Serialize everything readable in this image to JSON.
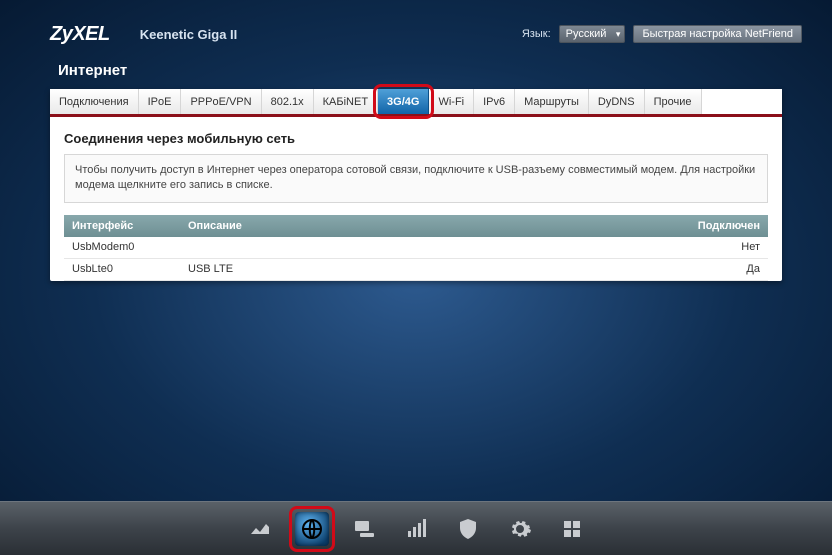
{
  "header": {
    "brand": "ZyXEL",
    "device": "Keenetic Giga II",
    "lang_label": "Язык:",
    "lang_value": "Русский",
    "quick_setup": "Быстрая настройка NetFriend"
  },
  "page_title": "Интернет",
  "tabs": [
    {
      "label": "Подключения",
      "active": false
    },
    {
      "label": "IPoE",
      "active": false
    },
    {
      "label": "PPPoE/VPN",
      "active": false
    },
    {
      "label": "802.1x",
      "active": false
    },
    {
      "label": "КАБiNET",
      "active": false
    },
    {
      "label": "3G/4G",
      "active": true
    },
    {
      "label": "Wi-Fi",
      "active": false
    },
    {
      "label": "IPv6",
      "active": false
    },
    {
      "label": "Маршруты",
      "active": false
    },
    {
      "label": "DyDNS",
      "active": false
    },
    {
      "label": "Прочие",
      "active": false
    }
  ],
  "section": {
    "title": "Соединения через мобильную сеть",
    "description": "Чтобы получить доступ в Интернет через оператора сотовой связи, подключите к USB-разъему совместимый модем. Для настройки модема щелкните его запись в списке."
  },
  "table": {
    "columns": {
      "iface": "Интерфейс",
      "desc": "Описание",
      "conn": "Подключен"
    },
    "rows": [
      {
        "iface": "UsbModem0",
        "desc": "",
        "conn": "Нет"
      },
      {
        "iface": "UsbLte0",
        "desc": "USB LTE",
        "conn": "Да"
      }
    ]
  },
  "dock": [
    {
      "name": "status-icon",
      "active": false
    },
    {
      "name": "internet-icon",
      "active": true
    },
    {
      "name": "lan-icon",
      "active": false
    },
    {
      "name": "wifi-icon",
      "active": false
    },
    {
      "name": "firewall-icon",
      "active": false
    },
    {
      "name": "settings-icon",
      "active": false
    },
    {
      "name": "apps-icon",
      "active": false
    }
  ]
}
